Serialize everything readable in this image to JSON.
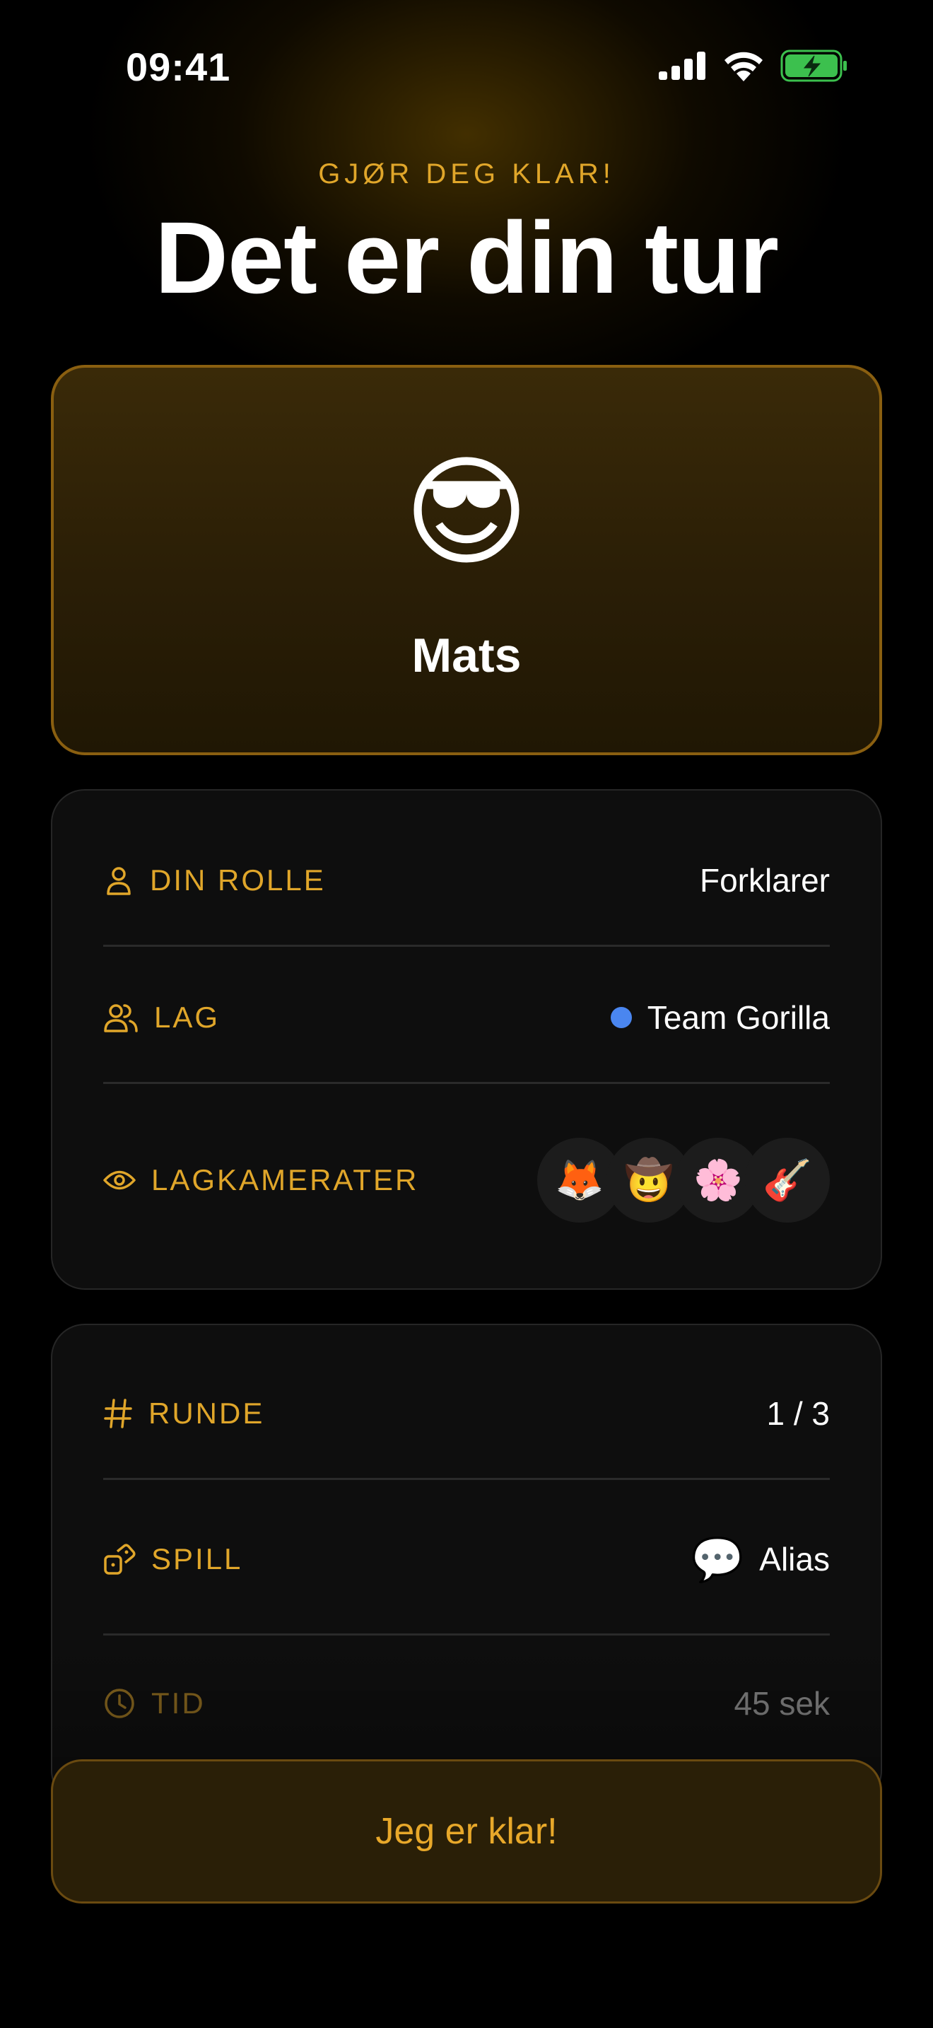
{
  "status_bar": {
    "time": "09:41"
  },
  "header": {
    "eyebrow": "GJØR DEG KLAR!",
    "title": "Det er din tur"
  },
  "player": {
    "emoji": "😎",
    "name": "Mats"
  },
  "role_card": {
    "role": {
      "label": "DIN ROLLE",
      "value": "Forklarer",
      "icon": "person-icon"
    },
    "team": {
      "label": "LAG",
      "value": "Team Gorilla",
      "color": "#4a86f0",
      "icon": "people-icon"
    },
    "teammates": {
      "label": "LAGKAMERATER",
      "icon": "eye-icon",
      "avatars": [
        "🦊",
        "🤠",
        "🌸",
        "🎸"
      ]
    }
  },
  "game_card": {
    "round": {
      "label": "RUNDE",
      "value": "1 / 3",
      "icon": "hash-icon"
    },
    "game": {
      "label": "SPILL",
      "value": "Alias",
      "value_emoji": "💬",
      "icon": "dice-icon"
    },
    "time": {
      "label": "TID",
      "value": "45 sek",
      "icon": "clock-icon"
    }
  },
  "ready_button": {
    "label": "Jeg er klar!"
  },
  "colors": {
    "accent": "#e0a62a",
    "background": "#000000",
    "card": "#0e0e0e",
    "team": "#4a86f0",
    "battery": "#3cc04e"
  }
}
